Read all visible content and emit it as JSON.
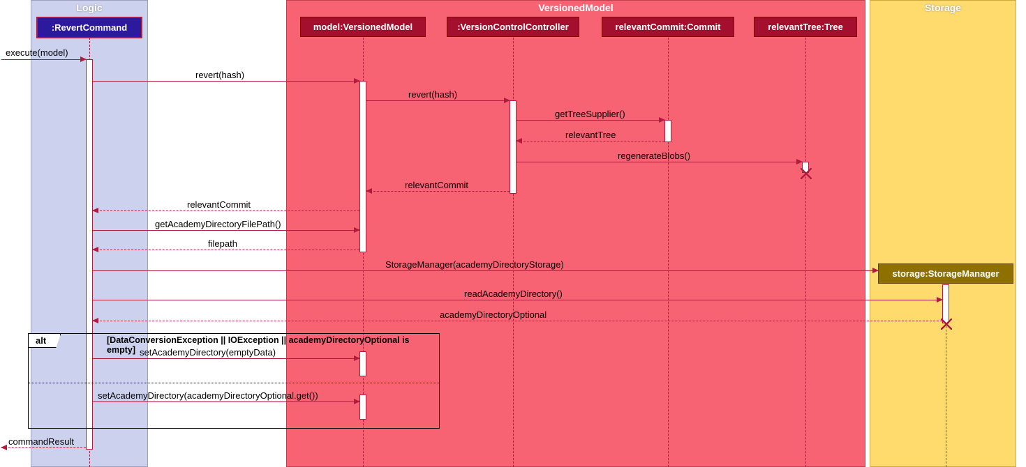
{
  "regions": {
    "logic": "Logic",
    "vmodel": "VersionedModel",
    "storage": "Storage"
  },
  "participants": {
    "revert": ":RevertCommand",
    "model": "model:VersionedModel",
    "vcc": ":VersionControlController",
    "commit": "relevantCommit:Commit",
    "tree": "relevantTree:Tree",
    "storage": "storage:StorageManager"
  },
  "messages": {
    "execute": "execute(model)",
    "revert1": "revert(hash)",
    "revert2": "revert(hash)",
    "getTree": "getTreeSupplier()",
    "relTree": "relevantTree",
    "regen": "regenerateBlobs()",
    "relCommit1": "relevantCommit",
    "relCommit2": "relevantCommit",
    "getPath": "getAcademyDirectoryFilePath()",
    "filepath": "filepath",
    "smgr": "StorageManager(academyDirectoryStorage)",
    "readAD": "readAcademyDirectory()",
    "adOpt": "academyDirectoryOptional",
    "setAD1": "setAcademyDirectory(emptyData)",
    "setAD2": "setAcademyDirectory(academyDirectoryOptional.get())",
    "cmdRes": "commandResult"
  },
  "alt": {
    "label": "alt",
    "guard": "[DataConversionException || IOException || academyDirectoryOptional is empty]"
  }
}
